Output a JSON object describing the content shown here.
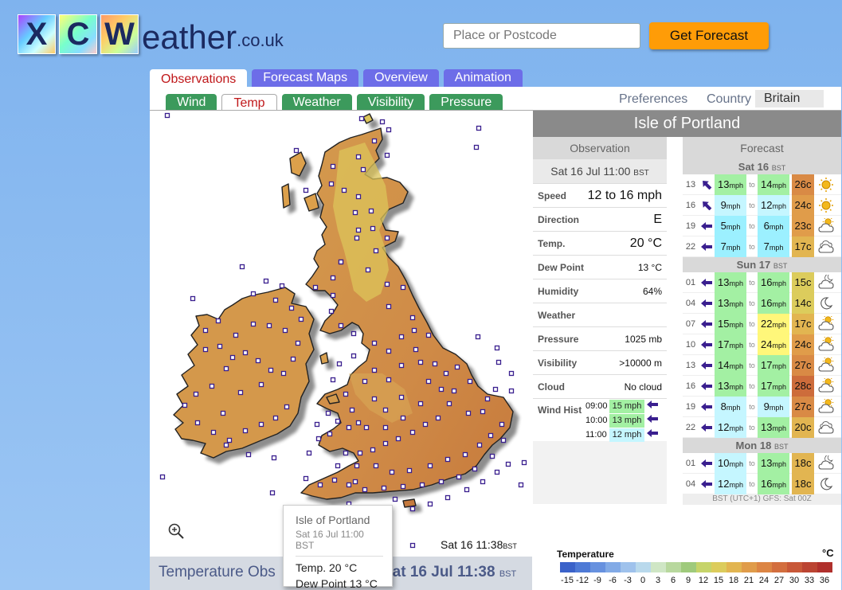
{
  "logo": {
    "letters": [
      "X",
      "C",
      "W"
    ],
    "word": "eather",
    "tld": ".co.uk"
  },
  "search": {
    "placeholder": "Place or Postcode",
    "button": "Get Forecast"
  },
  "main_tabs": [
    "Observations",
    "Forecast Maps",
    "Overview",
    "Animation"
  ],
  "sub_tabs": [
    "Wind",
    "Temp",
    "Weather",
    "Visibility",
    "Pressure"
  ],
  "header_links": {
    "preferences": "Preferences",
    "country_label": "Country",
    "country_value": "Britain"
  },
  "map": {
    "time": "Sat 16  11:38",
    "time_zone": "BST",
    "footer_title": "Temperature Obs",
    "footer_date": "Sat 16 Jul 11:38",
    "footer_zone": "BST"
  },
  "tooltip": {
    "name": "Isle of Portland",
    "date": "Sat 16 Jul 11:00",
    "zone": "BST",
    "temp": "Temp. 20 °C",
    "dew": "Dew Point 13 °C"
  },
  "legend": {
    "title": "Temperature",
    "unit": "°C",
    "labels": [
      "-15",
      "-12",
      "-9",
      "-6",
      "-3",
      "0",
      "3",
      "6",
      "9",
      "12",
      "15",
      "18",
      "21",
      "24",
      "27",
      "30",
      "33",
      "36"
    ],
    "colors": [
      "#3a62c9",
      "#4e7ad6",
      "#6791df",
      "#82aae6",
      "#9fc2ec",
      "#b9d9ec",
      "#cfe6c5",
      "#b8d89e",
      "#9fca7c",
      "#c6d46a",
      "#dccc5c",
      "#e2b551",
      "#e09c4a",
      "#dc8544",
      "#d36e3e",
      "#c85838",
      "#bb4432",
      "#b0302c"
    ]
  },
  "location": {
    "name": "Isle of Portland"
  },
  "observation": {
    "heading": "Observation",
    "date": "Sat 16 Jul 11:00",
    "zone": "BST",
    "rows": [
      {
        "label": "Speed",
        "value": "12 to 16 mph"
      },
      {
        "label": "Direction",
        "value": "E"
      },
      {
        "label": "Temp.",
        "value": "20 °C"
      },
      {
        "label": "Dew Point",
        "value": "13 °C"
      },
      {
        "label": "Humidity",
        "value": "64%"
      },
      {
        "label": "Weather",
        "value": ""
      },
      {
        "label": "Pressure",
        "value": "1025 mb"
      },
      {
        "label": "Visibility",
        "value": ">10000 m"
      },
      {
        "label": "Cloud",
        "value": "No cloud"
      }
    ],
    "wind_hist_label": "Wind Hist",
    "wind_hist": [
      {
        "time": "09:00",
        "speed": "15 mph",
        "color": "#a3f0a3"
      },
      {
        "time": "10:00",
        "speed": "13 mph",
        "color": "#a3f0a3"
      },
      {
        "time": "11:00",
        "speed": "12 mph",
        "color": "#c5f6ff"
      }
    ]
  },
  "forecast": {
    "heading": "Forecast",
    "days": [
      {
        "day": "Sat 16",
        "zone": "BST",
        "rows": [
          {
            "hour": "13",
            "dir": "nw",
            "lo": "13",
            "hi": "14",
            "lo_c": "#a3f0a3",
            "hi_c": "#a3f0a3",
            "temp": "26c",
            "temp_c": "#d98a45",
            "icon": "sun"
          },
          {
            "hour": "16",
            "dir": "nw",
            "lo": "9",
            "hi": "12",
            "lo_c": "#c5f6ff",
            "hi_c": "#c5f6ff",
            "temp": "24c",
            "temp_c": "#e09c4a",
            "icon": "sun"
          },
          {
            "hour": "19",
            "dir": "w",
            "lo": "5",
            "hi": "6",
            "lo_c": "#9cf0ff",
            "hi_c": "#9cf0ff",
            "temp": "23c",
            "temp_c": "#e09c4a",
            "icon": "partly"
          },
          {
            "hour": "22",
            "dir": "w",
            "lo": "7",
            "hi": "7",
            "lo_c": "#9cf0ff",
            "hi_c": "#9cf0ff",
            "temp": "17c",
            "temp_c": "#e2b551",
            "icon": "cloud"
          }
        ]
      },
      {
        "day": "Sun 17",
        "zone": "BST",
        "rows": [
          {
            "hour": "01",
            "dir": "w",
            "lo": "13",
            "hi": "16",
            "lo_c": "#a3f0a3",
            "hi_c": "#a3f0a3",
            "temp": "15c",
            "temp_c": "#dccc5c",
            "icon": "cloud-moon"
          },
          {
            "hour": "04",
            "dir": "w",
            "lo": "13",
            "hi": "16",
            "lo_c": "#a3f0a3",
            "hi_c": "#a3f0a3",
            "temp": "14c",
            "temp_c": "#dccc5c",
            "icon": "moon"
          },
          {
            "hour": "07",
            "dir": "w",
            "lo": "15",
            "hi": "22",
            "lo_c": "#a3f0a3",
            "hi_c": "#fff77a",
            "temp": "17c",
            "temp_c": "#e2b551",
            "icon": "partly"
          },
          {
            "hour": "10",
            "dir": "w",
            "lo": "17",
            "hi": "24",
            "lo_c": "#a3f0a3",
            "hi_c": "#fff77a",
            "temp": "24c",
            "temp_c": "#e09c4a",
            "icon": "partly"
          },
          {
            "hour": "13",
            "dir": "w",
            "lo": "14",
            "hi": "17",
            "lo_c": "#a3f0a3",
            "hi_c": "#a3f0a3",
            "temp": "27c",
            "temp_c": "#d98a45",
            "icon": "partly"
          },
          {
            "hour": "16",
            "dir": "w",
            "lo": "13",
            "hi": "17",
            "lo_c": "#a3f0a3",
            "hi_c": "#a3f0a3",
            "temp": "28c",
            "temp_c": "#cd6c3b",
            "icon": "partly"
          },
          {
            "hour": "19",
            "dir": "w",
            "lo": "8",
            "hi": "9",
            "lo_c": "#c5f6ff",
            "hi_c": "#c5f6ff",
            "temp": "27c",
            "temp_c": "#d98a45",
            "icon": "partly"
          },
          {
            "hour": "22",
            "dir": "w",
            "lo": "12",
            "hi": "13",
            "lo_c": "#c5f6ff",
            "hi_c": "#a3f0a3",
            "temp": "20c",
            "temp_c": "#e2b551",
            "icon": "cloud"
          }
        ]
      },
      {
        "day": "Mon 18",
        "zone": "BST",
        "rows": [
          {
            "hour": "01",
            "dir": "w",
            "lo": "10",
            "hi": "13",
            "lo_c": "#c5f6ff",
            "hi_c": "#a3f0a3",
            "temp": "18c",
            "temp_c": "#e2b551",
            "icon": "cloud-moon"
          },
          {
            "hour": "04",
            "dir": "w",
            "lo": "12",
            "hi": "16",
            "lo_c": "#c5f6ff",
            "hi_c": "#a3f0a3",
            "temp": "18c",
            "temp_c": "#e2b551",
            "icon": "moon"
          }
        ]
      }
    ],
    "units": {
      "mph": "mph",
      "to": "to"
    },
    "footer": "BST (UTC+1) GFS: Sat 00Z"
  }
}
